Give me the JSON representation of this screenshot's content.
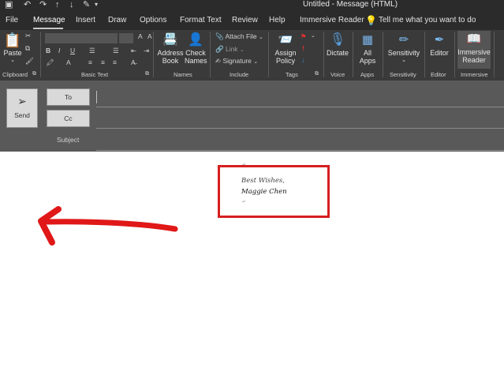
{
  "window": {
    "title": "Untitled  -  Message (HTML)"
  },
  "tabs": [
    "File",
    "Message",
    "Insert",
    "Draw",
    "Options",
    "Format Text",
    "Review",
    "Help",
    "Immersive Reader"
  ],
  "tellme": "Tell me what you want to do",
  "ribbon": {
    "paste": "Paste",
    "clipboard": "Clipboard",
    "basic_text": "Basic Text",
    "address_book": [
      "Address",
      "Book"
    ],
    "check_names": [
      "Check",
      "Names"
    ],
    "names": "Names",
    "attach_file": "Attach File",
    "link": "Link",
    "signature": "Signature",
    "include": "Include",
    "assign_policy": [
      "Assign",
      "Policy"
    ],
    "tags": "Tags",
    "dictate": "Dictate",
    "voice": "Voice",
    "all_apps": [
      "All",
      "Apps"
    ],
    "apps": "Apps",
    "sensitivity": "Sensitivity",
    "sensitivity_group": "Sensitivity",
    "editor": "Editor",
    "editor_group": "Editor",
    "immersive_reader": [
      "Immersive",
      "Reader"
    ],
    "immersive_group": "Immersive"
  },
  "compose": {
    "send": "Send",
    "to": "To",
    "cc": "Cc",
    "subject": "Subject"
  },
  "signature_block": {
    "line1": "Best Wishes,",
    "line2": "Maggie Chen"
  },
  "colors": {
    "accent": "#d61f1f",
    "ribbon": "#3a3a3a",
    "header": "#595959"
  }
}
